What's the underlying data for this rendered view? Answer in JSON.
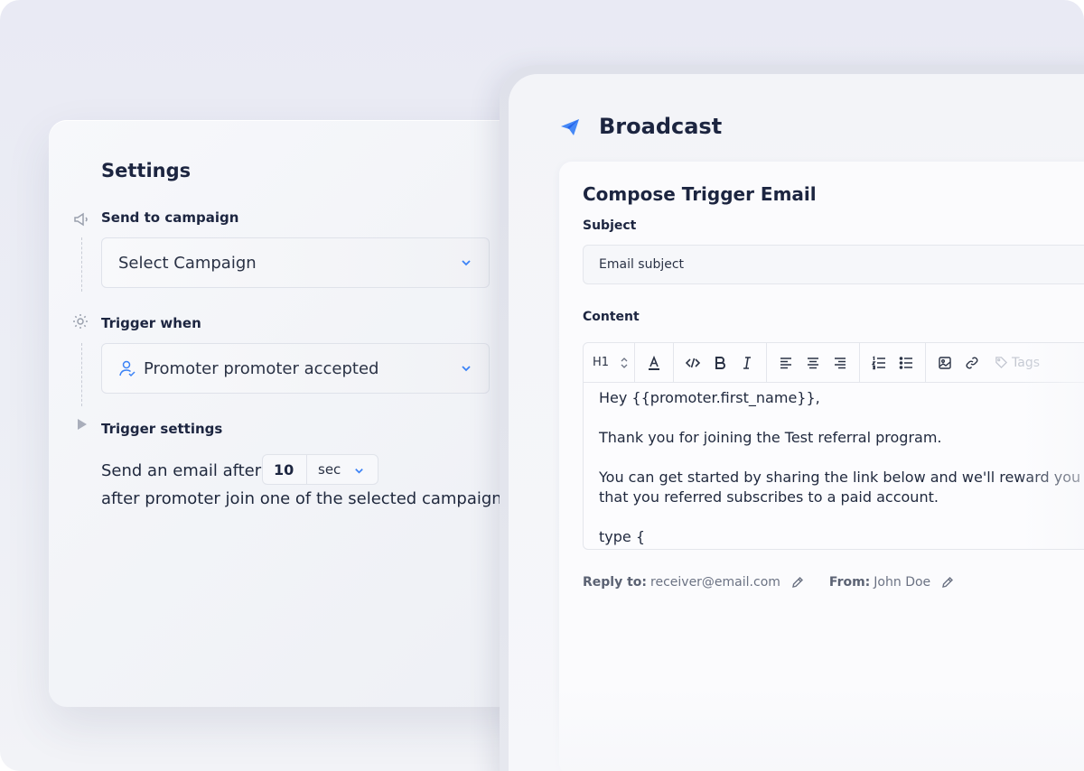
{
  "settings": {
    "title": "Settings",
    "send_to_campaign": {
      "label": "Send to campaign",
      "select_value": "Select Campaign"
    },
    "trigger_when": {
      "label": "Trigger when",
      "select_value": "Promoter promoter accepted"
    },
    "trigger_settings": {
      "label": "Trigger settings",
      "text_before": "Send an email after",
      "delay_value": "10",
      "delay_unit": "sec",
      "text_after": "after promoter join one of the selected campaign"
    }
  },
  "broadcast": {
    "title": "Broadcast",
    "compose": {
      "title": "Compose Trigger Email",
      "subject_label": "Subject",
      "subject_value": "Email subject",
      "content_label": "Content",
      "toolbar": {
        "heading": "H1",
        "tags_label": "Tags"
      },
      "body_lines": [
        "Hey {{promoter.first_name}},",
        "Thank you for joining the Test referral program.",
        "You can get started by sharing the link below and we'll reward you e",
        "that you referred subscribes to a paid account.",
        "type {"
      ],
      "reply_to_label": "Reply to:",
      "reply_to_value": "receiver@email.com",
      "from_label": "From:",
      "from_value": "John Doe"
    }
  },
  "colors": {
    "accent": "#3b82f6",
    "text_dark": "#1c2540",
    "muted": "#9aa0ad"
  }
}
